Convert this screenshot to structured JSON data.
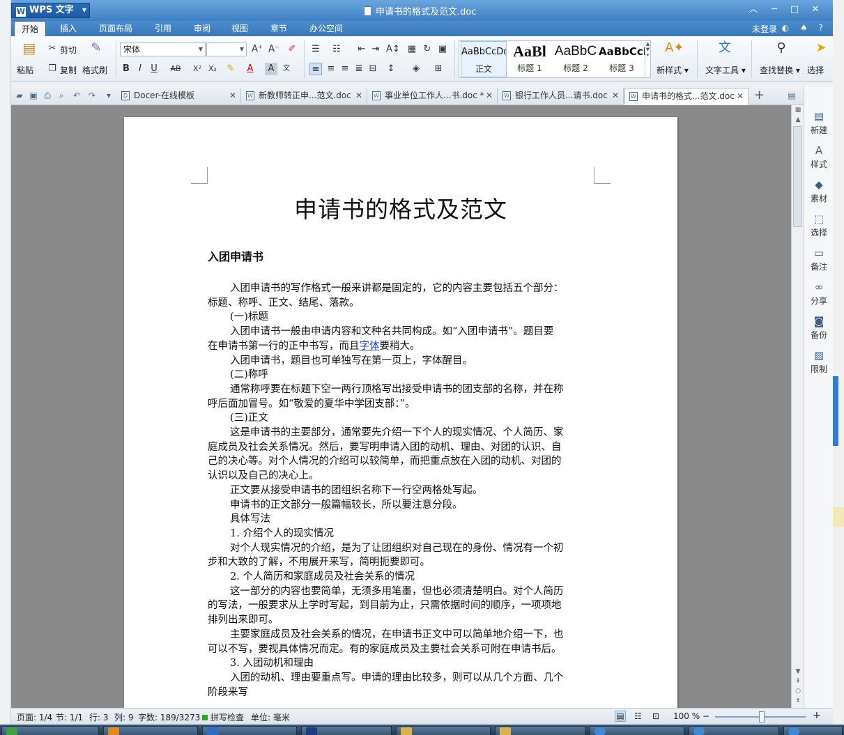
{
  "window": {
    "app_menu": "WPS 文字",
    "doc_title": "申请书的格式及范文.doc"
  },
  "menu": {
    "tabs": [
      "开始",
      "插入",
      "页面布局",
      "引用",
      "审阅",
      "视图",
      "章节",
      "办公空间"
    ],
    "login": "未登录"
  },
  "ribbon": {
    "paste": "粘贴",
    "cut": "剪切",
    "copy": "复制",
    "format_painter": "格式刷",
    "font_name": "宋体",
    "font_size": "",
    "styles": [
      {
        "preview": "AaBbCcDd",
        "name": "正文"
      },
      {
        "preview": "AaBl",
        "name": "标题 1"
      },
      {
        "preview": "AaBbC",
        "name": "标题 2"
      },
      {
        "preview": "AaBbCcI",
        "name": "标题 3"
      }
    ],
    "new_style": "新样式",
    "text_tools": "文字工具",
    "find_replace": "查找替换",
    "select": "选择"
  },
  "doc_tabs": [
    {
      "label": "Docer-在线模板"
    },
    {
      "label": "新教师转正申...范文.doc"
    },
    {
      "label": "事业单位工作人...书.doc *"
    },
    {
      "label": "银行工作人员...请书.doc"
    },
    {
      "label": "申请书的格式...范文.doc"
    }
  ],
  "side_panel": [
    "新建",
    "样式",
    "素材",
    "选择",
    "备注",
    "分享",
    "备份",
    "限制"
  ],
  "document": {
    "title": "申请书的格式及范文",
    "heading": "入团申请书",
    "lines": [
      {
        "t": "入团申请书的写作格式一般来讲都是固定的，它的内容主要包括五个部分：",
        "i": true
      },
      {
        "t": "标题、称呼、正文、结尾、落款。",
        "i": false
      },
      {
        "t": "(一)标题",
        "i": true
      },
      {
        "t": "入团申请书一般由申请内容和文种名共同构成。如“入团申请书”。题目要",
        "i": true
      },
      {
        "t": "在申请书第一行的正中书写，而且字体要稍大。",
        "i": false
      },
      {
        "t": "入团申请书，题目也可单独写在第一页上，字体醒目。",
        "i": true
      },
      {
        "t": "(二)称呼",
        "i": true
      },
      {
        "t": "通常称呼要在标题下空一两行顶格写出接受申请书的团支部的名称，并在称",
        "i": true
      },
      {
        "t": "呼后面加冒号。如“敬爱的夏华中学团支部：”。",
        "i": false
      },
      {
        "t": "(三)正文",
        "i": true
      },
      {
        "t": "这是申请书的主要部分，通常要先介绍一下个人的现实情况、个人简历、家",
        "i": true
      },
      {
        "t": "庭成员及社会关系情况。然后，要写明申请入团的动机、理由、对团的认识、自",
        "i": false
      },
      {
        "t": "己的决心等。对个人情况的介绍可以较简单，而把重点放在入团的动机、对团的",
        "i": false
      },
      {
        "t": "认识以及自己的决心上。",
        "i": false
      },
      {
        "t": "正文要从接受申请书的团组织名称下一行空两格处写起。",
        "i": true
      },
      {
        "t": "申请书的正文部分一般篇幅较长，所以要注意分段。",
        "i": true
      },
      {
        "t": "具体写法",
        "i": true
      },
      {
        "t": "1. 介绍个人的现实情况",
        "i": true
      },
      {
        "t": "对个人现实情况的介绍，是为了让团组织对自己现在的身份、情况有一个初",
        "i": true
      },
      {
        "t": "步和大致的了解，不用展开来写，简明扼要即可。",
        "i": false
      },
      {
        "t": "2. 个人简历和家庭成员及社会关系的情况",
        "i": true
      },
      {
        "t": "这一部分的内容也要简单，无须多用笔墨，但也必须清楚明白。对个人简历",
        "i": true
      },
      {
        "t": "的写法，一般要求从上学时写起，到目前为止，只需依据时间的顺序，一项项地",
        "i": false
      },
      {
        "t": "排列出来即可。",
        "i": false
      },
      {
        "t": "主要家庭成员及社会关系的情况，在申请书正文中可以简单地介绍一下，也",
        "i": true
      },
      {
        "t": "可以不写，要视具体情况而定。有的家庭成员及主要社会关系可附在申请书后。",
        "i": false
      },
      {
        "t": "3. 入团动机和理由",
        "i": true
      },
      {
        "t": "入团的动机、理由要重点写。申请的理由比较多，则可以从几个方面、几个",
        "i": true
      },
      {
        "t": "阶段来写",
        "i": false
      }
    ]
  },
  "status": {
    "page": "页面: 1/4",
    "section": "节: 1/1",
    "row": "行: 3",
    "col": "列: 9",
    "words": "字数: 189/3273",
    "spell": "拼写检查",
    "unit": "单位: 毫米",
    "zoom": "100 %",
    "zoom_level_percent": 100
  }
}
